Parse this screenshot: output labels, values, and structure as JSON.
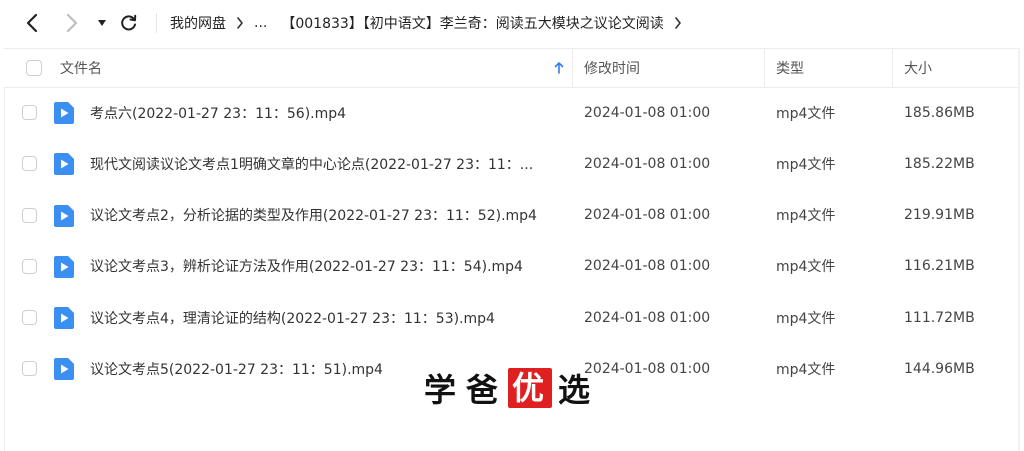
{
  "toolbar": {
    "back_icon": "chevron-left-icon",
    "forward_icon": "chevron-right-icon",
    "dropdown_icon": "caret-down-icon",
    "refresh_icon": "refresh-icon"
  },
  "breadcrumb": {
    "root": "我的网盘",
    "ellipsis": "...",
    "current": "【001833】【初中语文】李兰奇：阅读五大模块之议论文阅读"
  },
  "table": {
    "headers": {
      "name": "文件名",
      "mtime": "修改时间",
      "type": "类型",
      "size": "大小"
    },
    "sort": "name-ascending",
    "rows": [
      {
        "name": "考点六(2022-01-27 23：11：56).mp4",
        "mtime": "2024-01-08 01:00",
        "type": "mp4文件",
        "size": "185.86MB"
      },
      {
        "name": "现代文阅读议论文考点1明确文章的中心论点(2022-01-27 23：11：...",
        "mtime": "2024-01-08 01:00",
        "type": "mp4文件",
        "size": "185.22MB"
      },
      {
        "name": "议论文考点2，分析论据的类型及作用(2022-01-27 23：11：52).mp4",
        "mtime": "2024-01-08 01:00",
        "type": "mp4文件",
        "size": "219.91MB"
      },
      {
        "name": "议论文考点3，辨析论证方法及作用(2022-01-27 23：11：54).mp4",
        "mtime": "2024-01-08 01:00",
        "type": "mp4文件",
        "size": "116.21MB"
      },
      {
        "name": "议论文考点4，理清论证的结构(2022-01-27 23：11：53).mp4",
        "mtime": "2024-01-08 01:00",
        "type": "mp4文件",
        "size": "111.72MB"
      },
      {
        "name": "议论文考点5(2022-01-27 23：11：51).mp4",
        "mtime": "2024-01-08 01:00",
        "type": "mp4文件",
        "size": "144.96MB"
      }
    ]
  },
  "watermark": {
    "chars": [
      "学",
      "爸",
      "优",
      "选"
    ],
    "accent_color": "#e02020"
  },
  "colors": {
    "file_icon": "#3b8ff0",
    "sort_arrow": "#2f80ed"
  }
}
